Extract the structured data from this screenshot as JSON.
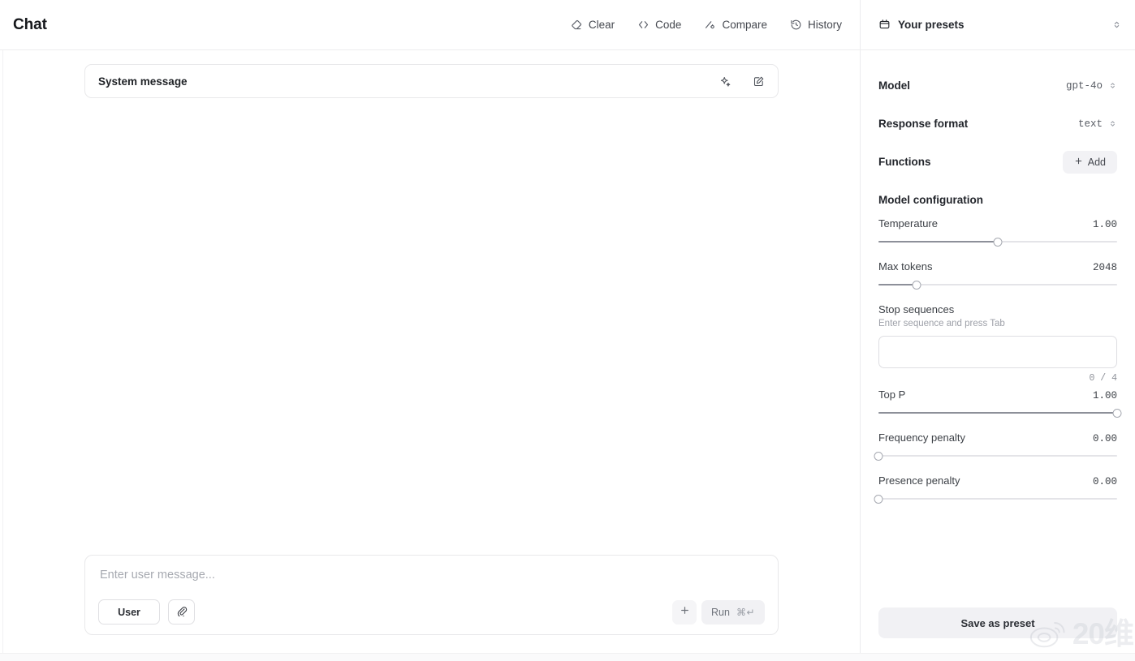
{
  "header": {
    "title": "Chat",
    "actions": [
      {
        "label": "Clear",
        "icon": "eraser-icon"
      },
      {
        "label": "Code",
        "icon": "code-brackets-icon"
      },
      {
        "label": "Compare",
        "icon": "compare-icon"
      },
      {
        "label": "History",
        "icon": "history-clock-icon"
      }
    ],
    "presets_label": "Your presets",
    "presets_icon": "preset-box-icon",
    "presets_chevrons_icon": "chevron-up-down-icon"
  },
  "chat": {
    "system_message_label": "System message",
    "system_icons": [
      {
        "name": "sparkles-icon"
      },
      {
        "name": "edit-square-icon"
      }
    ],
    "composer": {
      "placeholder": "Enter user message...",
      "role_label": "User",
      "attach_icon": "paperclip-icon",
      "add_icon": "plus-icon",
      "run_label": "Run",
      "run_shortcut": "⌘↵"
    }
  },
  "settings": {
    "rows": [
      {
        "label": "Model",
        "value": "gpt-4o"
      },
      {
        "label": "Response format",
        "value": "text"
      }
    ],
    "functions": {
      "label": "Functions",
      "add_label": "Add",
      "add_icon": "plus-icon"
    },
    "model_config_title": "Model configuration",
    "params": [
      {
        "label": "Temperature",
        "value": "1.00",
        "percent": 50
      },
      {
        "label": "Max tokens",
        "value": "2048",
        "percent": 16
      }
    ],
    "stop_sequences": {
      "label": "Stop sequences",
      "description": "Enter sequence and press Tab",
      "value": "",
      "count": "0 / 4"
    },
    "params2": [
      {
        "label": "Top P",
        "value": "1.00",
        "percent": 100
      },
      {
        "label": "Frequency penalty",
        "value": "0.00",
        "percent": 0
      },
      {
        "label": "Presence penalty",
        "value": "0.00",
        "percent": 0
      }
    ],
    "save_preset_label": "Save as preset"
  },
  "watermark": {
    "text": "20维"
  }
}
